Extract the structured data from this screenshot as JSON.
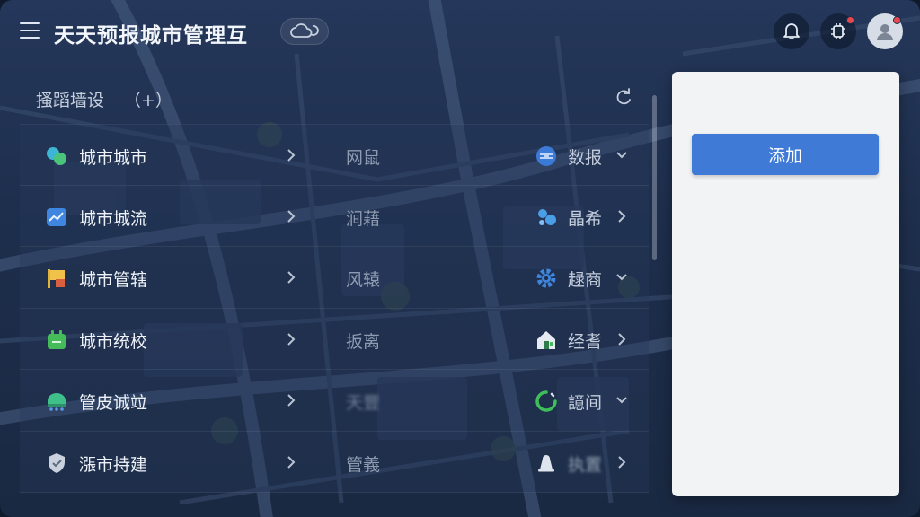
{
  "header": {
    "title": "天天预报城市管理互",
    "icons": [
      "menu-icon",
      "weather-cloud-icon",
      "bell-icon",
      "status-icon",
      "user-icon"
    ],
    "notification_color": "#e8484d"
  },
  "section": {
    "title": "搔蹈墙设",
    "extra": "（+）"
  },
  "rows": [
    {
      "name": "城市城市",
      "mid": "网鼠",
      "right": "数报",
      "left_icon": "bubbles-icon",
      "right_icon": "globe-icon",
      "chevron": "down"
    },
    {
      "name": "城市城流",
      "mid": "涧藉",
      "right": "晶希",
      "left_icon": "chart-icon",
      "right_icon": "gear-icon",
      "chevron": "right"
    },
    {
      "name": "城市管辖",
      "mid": "风辕",
      "right": "趢商",
      "left_icon": "flag-icon",
      "right_icon": "gear-icon",
      "chevron": "down"
    },
    {
      "name": "城市统校",
      "mid": "扳离",
      "right": "经耆",
      "left_icon": "box-icon",
      "right_icon": "home-icon",
      "chevron": "right"
    },
    {
      "name": "管皮诚竝",
      "mid": "天豐",
      "right": "譩间",
      "left_icon": "bus-icon",
      "right_icon": "loading-icon",
      "chevron": "down"
    },
    {
      "name": "漲市持建",
      "mid": "管義",
      "right": "执置",
      "left_icon": "shield-icon",
      "right_icon": "bell-icon",
      "chevron": "right"
    }
  ],
  "panel": {
    "add_label": "添加"
  },
  "colors": {
    "accent": "#3e7ad6",
    "background": "#1d2e4c",
    "panel": "#f2f3f5"
  }
}
